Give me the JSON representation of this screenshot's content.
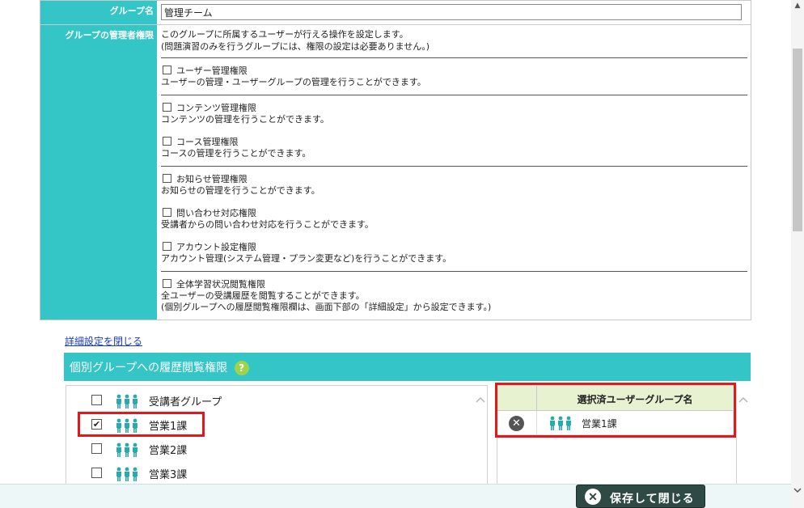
{
  "form": {
    "group_name_label": "グループ名",
    "group_name_value": "管理チーム",
    "admin_perm_label": "グループの管理者権限",
    "admin_perm_desc1": "このグループに所属するユーザーが行える操作を設定します。",
    "admin_perm_desc2": "(問題演習のみを行うグループには、権限の設定は必要ありません。)",
    "perm_groups": [
      [
        {
          "name": "ユーザー管理権限",
          "desc": [
            "ユーザーの管理・ユーザーグループの管理を行うことができます。"
          ]
        }
      ],
      [
        {
          "name": "コンテンツ管理権限",
          "desc": [
            "コンテンツの管理を行うことができます。"
          ]
        },
        {
          "name": "コース管理権限",
          "desc": [
            "コースの管理を行うことができます。"
          ]
        }
      ],
      [
        {
          "name": "お知らせ管理権限",
          "desc": [
            "お知らせの管理を行うことができます。"
          ]
        },
        {
          "name": "問い合わせ対応権限",
          "desc": [
            "受講者からの問い合わせ対応を行うことができます。"
          ]
        },
        {
          "name": "アカウント設定権限",
          "desc": [
            "アカウント管理(システム管理・プラン変更など)を行うことができます。"
          ]
        }
      ],
      [
        {
          "name": "全体学習状況閲覧権限",
          "desc": [
            "全ユーザーの受講履歴を閲覧することができます。",
            "(個別グループへの履歴閲覧権限欄は、画面下部の「詳細設定」から設定できます。)"
          ]
        }
      ]
    ]
  },
  "close_detail_link": "詳細設定を閉じる",
  "history_section": {
    "title": "個別グループへの履歴閲覧権限",
    "help": "?"
  },
  "group_list": [
    {
      "name": "受講者グループ",
      "checked": false
    },
    {
      "name": "営業1課",
      "checked": true
    },
    {
      "name": "営業2課",
      "checked": false
    },
    {
      "name": "営業3課",
      "checked": false
    }
  ],
  "selected_table": {
    "header": "選択済ユーザーグループ名",
    "rows": [
      {
        "name": "営業1課"
      }
    ]
  },
  "footer": {
    "save_label": "保存して閉じる"
  },
  "colors": {
    "teal": "#34c6c6",
    "highlight_red": "#e11919",
    "save_button": "#2f4a44",
    "help_green": "#9cd44a"
  }
}
